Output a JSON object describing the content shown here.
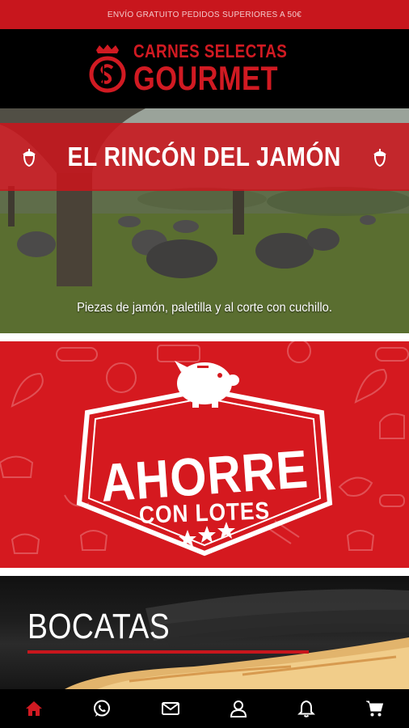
{
  "topbar": {
    "text": "ENVÍO GRATUITO PEDIDOS SUPERIORES A 50€"
  },
  "logo": {
    "line1": "CARNES SELECTAS",
    "line2": "GOURMET"
  },
  "hero": {
    "title": "EL RINCÓN DEL JAMÓN",
    "caption": "Piezas de jamón, paletilla y al corte con cuchillo."
  },
  "promo": {
    "line1": "AHORRE",
    "line2": "CON LOTES"
  },
  "bocatas": {
    "title": "BOCATAS"
  },
  "colors": {
    "brand_red": "#c8161d",
    "header_bg": "#000000",
    "text_light": "#ffffff"
  },
  "bottom_nav": [
    {
      "icon": "home-icon",
      "active": true
    },
    {
      "icon": "whatsapp-icon",
      "active": false
    },
    {
      "icon": "mail-icon",
      "active": false
    },
    {
      "icon": "user-icon",
      "active": false
    },
    {
      "icon": "bell-icon",
      "active": false
    },
    {
      "icon": "cart-icon",
      "active": false
    }
  ]
}
